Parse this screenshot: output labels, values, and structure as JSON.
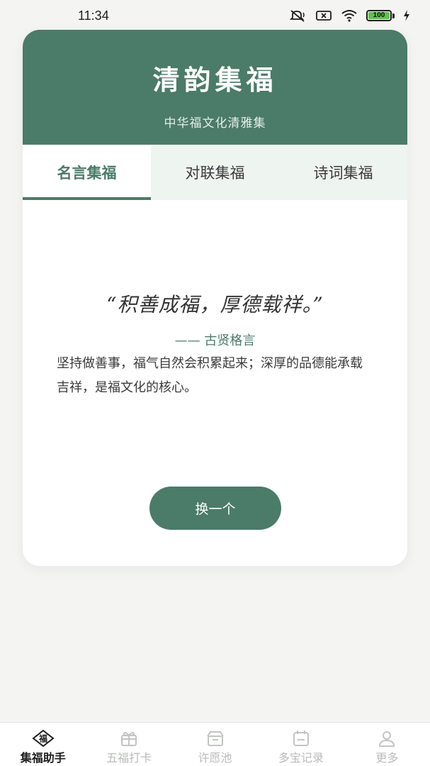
{
  "status": {
    "time": "11:34",
    "battery": "100",
    "icons": [
      "mute-icon",
      "sim-off-icon",
      "wifi-icon",
      "battery-icon",
      "charging-icon"
    ]
  },
  "header": {
    "title": "清韵集福",
    "subtitle": "中华福文化清雅集"
  },
  "tabs": [
    {
      "label": "名言集福",
      "active": true
    },
    {
      "label": "对联集福",
      "active": false
    },
    {
      "label": "诗词集福",
      "active": false
    }
  ],
  "quote": {
    "text": "“积善成福，厚德载祥。”",
    "source": "—— 古贤格言",
    "explanation": "坚持做善事，福气自然会积累起来；深厚的品德能承载吉祥，是福文化的核心。"
  },
  "actions": {
    "refresh_label": "换一个"
  },
  "nav": {
    "items": [
      {
        "label": "集福助手",
        "icon": "fu-diamond-icon",
        "active": true
      },
      {
        "label": "五福打卡",
        "icon": "gift-icon",
        "active": false
      },
      {
        "label": "许愿池",
        "icon": "box-icon",
        "active": false
      },
      {
        "label": "多宝记录",
        "icon": "calendar-icon",
        "active": false
      },
      {
        "label": "更多",
        "icon": "user-icon",
        "active": false
      }
    ],
    "fu_glyph": "福"
  },
  "colors": {
    "brand": "#4b7b69",
    "tab_bg": "#eef4f0",
    "page_bg": "#f4f5f2"
  }
}
